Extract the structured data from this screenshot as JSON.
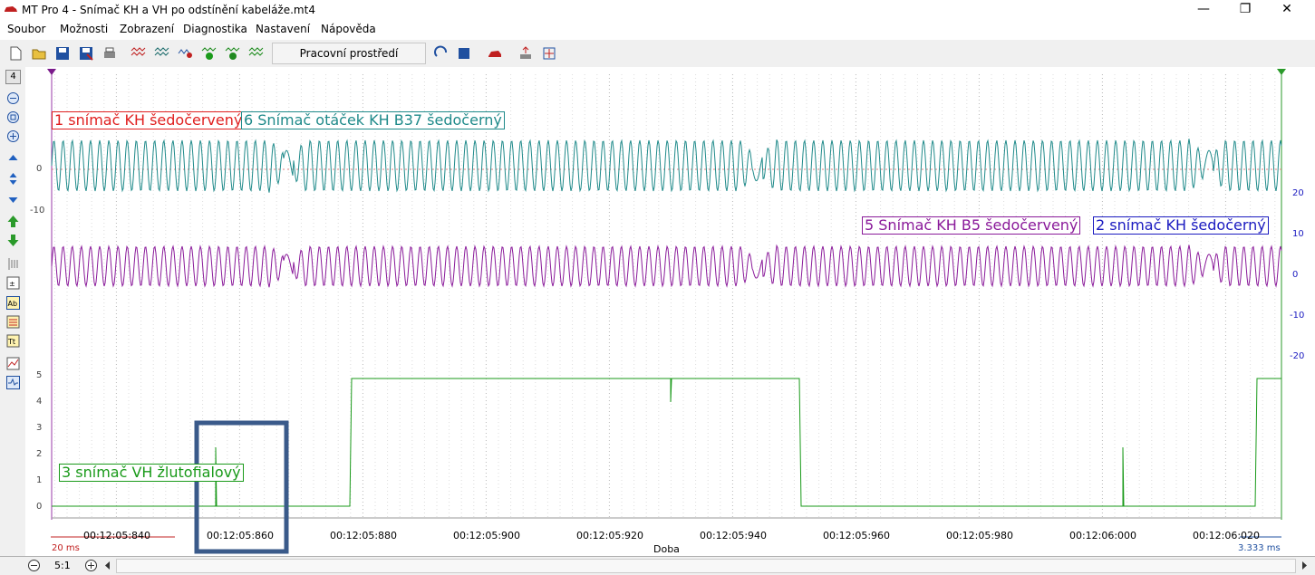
{
  "window": {
    "title": "MT Pro 4 - Snímač KH a VH po odstínění kabeláže.mt4"
  },
  "menu": [
    "Soubor",
    "Možnosti",
    "Zobrazení",
    "Diagnostika",
    "Nastavení",
    "Nápověda"
  ],
  "toolbar": {
    "workspace_label": "Pracovní prostředí"
  },
  "left_toolbar": {
    "channel_count": "4"
  },
  "channels": {
    "ch1": "1 snímač KH šedočervený",
    "ch6": "6 Snímač otáček KH B37 šedočerný",
    "ch5": "5 Snímač KH B5 šedočervený",
    "ch2": "2 snímač KH šedočerný",
    "ch3": "3 snímač VH žlutofialový"
  },
  "axes": {
    "top_left": [
      "0",
      "-10"
    ],
    "right": [
      "20",
      "10",
      "0",
      "-10",
      "-20"
    ],
    "bottom_left": [
      "5",
      "4",
      "3",
      "2",
      "1",
      "0"
    ],
    "time_ticks": [
      "00:12:05:840",
      "00:12:05:860",
      "00:12:05:880",
      "00:12:05:900",
      "00:12:05:920",
      "00:12:05:940",
      "00:12:05:960",
      "00:12:05:980",
      "00:12:06:000",
      "00:12:06:020"
    ],
    "time_label": "Doba",
    "left_scale": "20 ms",
    "right_scale": "3.333 ms"
  },
  "bottom": {
    "zoom": "5:1"
  },
  "colors": {
    "ch1": "#e02020",
    "ch6": "#1f8a8a",
    "ch5": "#8a1a9a",
    "ch2": "#1a1ac0",
    "ch3": "#1a9a1a",
    "highlight": "#3a5a8a"
  }
}
